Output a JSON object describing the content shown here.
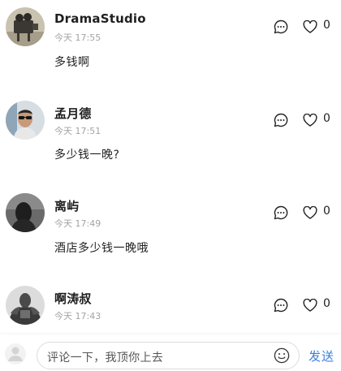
{
  "comments": [
    {
      "username": "DramaStudio",
      "time": "今天 17:55",
      "content": "多钱啊",
      "likes": "0",
      "avatar_icon": "movie-camera-avatar"
    },
    {
      "username": "孟月德",
      "time": "今天 17:51",
      "content": "多少钱一晚?",
      "likes": "0",
      "avatar_icon": "sunglasses-man-avatar"
    },
    {
      "username": "离屿",
      "time": "今天 17:49",
      "content": "酒店多少钱一晚哦",
      "likes": "0",
      "avatar_icon": "dark-silhouette-avatar"
    },
    {
      "username": "啊涛叔",
      "time": "今天 17:43",
      "content": "",
      "likes": "0",
      "avatar_icon": "muscle-man-avatar"
    }
  ],
  "input": {
    "placeholder": "评论一下，我顶你上去"
  },
  "send_label": "发送",
  "icons": {
    "reply": "comment-bubble-icon",
    "like": "heart-icon",
    "emoji": "emoji-icon",
    "user": "user-avatar-icon"
  },
  "colors": {
    "send": "#3a7fd8",
    "time": "#a3a3a3",
    "text": "#222222"
  }
}
